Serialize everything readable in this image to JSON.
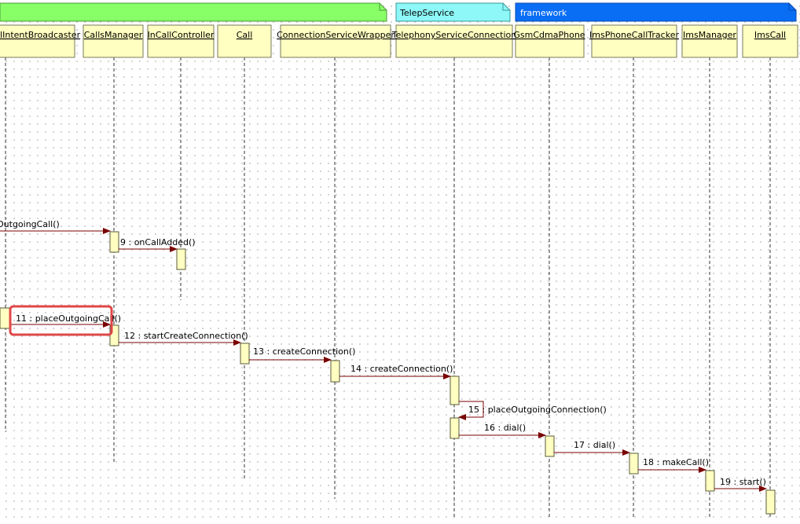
{
  "colors": {
    "partition_green": "#88ff66",
    "partition_cyan": "#8ef7f7",
    "partition_blue": "#0a6ef5",
    "lifeline_fill": "#ffffc1",
    "message_line": "#7a0000",
    "highlight": "#e04848"
  },
  "partitions": [
    {
      "name": "",
      "color": "#88ff66",
      "text_color": "#000000"
    },
    {
      "name": "TelepService",
      "color": "#8ef7f7",
      "text_color": "#000000"
    },
    {
      "name": "framework",
      "color": "#0a6ef5",
      "text_color": "#ffffff"
    }
  ],
  "lifelines": [
    "llIntentBroadcaster",
    "CallsManager",
    "InCallController",
    "Call",
    "ConnectionServiceWrapper",
    "TelephonyServiceConnection",
    "GsmCdmaPhone",
    "ImsPhoneCallTracker",
    "ImsManager",
    "ImsCall"
  ],
  "messages": [
    {
      "label": "OutgoingCall()",
      "from": 0,
      "to": 1
    },
    {
      "label": "9 : onCallAdded()",
      "from": 1,
      "to": 2
    },
    {
      "label": "11 : placeOutgoingCall()",
      "from": 0,
      "to": 1,
      "highlighted": true
    },
    {
      "label": "12 : startCreateConnection()",
      "from": 1,
      "to": 3
    },
    {
      "label": "13 : createConnection()",
      "from": 3,
      "to": 4
    },
    {
      "label": "14 : createConnection()",
      "from": 4,
      "to": 5
    },
    {
      "label": "15 : placeOutgoingConnection()",
      "from": 5,
      "to": 5
    },
    {
      "label": "16 : dial()",
      "from": 5,
      "to": 6
    },
    {
      "label": "17 : dial()",
      "from": 6,
      "to": 7
    },
    {
      "label": "18 : makeCall()",
      "from": 7,
      "to": 8
    },
    {
      "label": "19 : start()",
      "from": 8,
      "to": 9
    }
  ]
}
